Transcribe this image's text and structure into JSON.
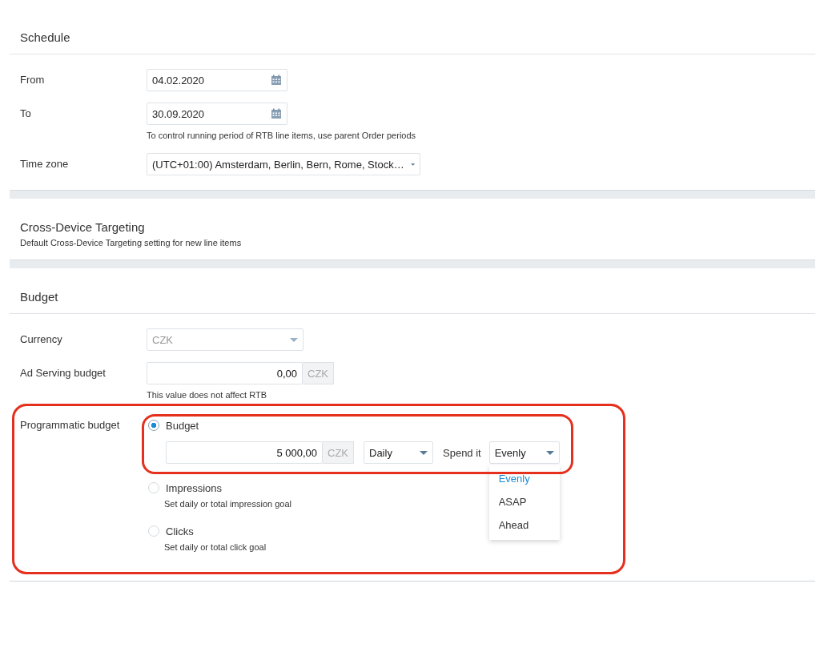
{
  "schedule": {
    "title": "Schedule",
    "from": {
      "label": "From",
      "value": "04.02.2020"
    },
    "to": {
      "label": "To",
      "value": "30.09.2020",
      "hint": "To control running period of RTB line items, use parent Order periods"
    },
    "time_zone": {
      "label": "Time zone",
      "value": "(UTC+01:00) Amsterdam, Berlin, Bern, Rome, Stock…"
    }
  },
  "cross_device": {
    "title": "Cross-Device Targeting",
    "subtitle": "Default Cross-Device Targeting setting for new line items"
  },
  "budget": {
    "title": "Budget",
    "currency": {
      "label": "Currency",
      "value": "CZK",
      "disabled": true
    },
    "ad_serving": {
      "label": "Ad Serving budget",
      "value": "0,00",
      "unit": "CZK",
      "hint": "This value does not affect RTB"
    },
    "programmatic": {
      "label": "Programmatic budget",
      "options": [
        {
          "label": "Budget",
          "selected": true
        },
        {
          "label": "Impressions",
          "selected": false,
          "hint": "Set daily or total impression goal"
        },
        {
          "label": "Clicks",
          "selected": false,
          "hint": "Set daily or total click goal"
        }
      ],
      "amount": "5 000,00",
      "unit": "CZK",
      "period": "Daily",
      "spend_label": "Spend it",
      "spend_value": "Evenly",
      "spend_menu": [
        {
          "label": "Evenly",
          "selected": true
        },
        {
          "label": "ASAP",
          "selected": false
        },
        {
          "label": "Ahead",
          "selected": false
        }
      ]
    }
  }
}
